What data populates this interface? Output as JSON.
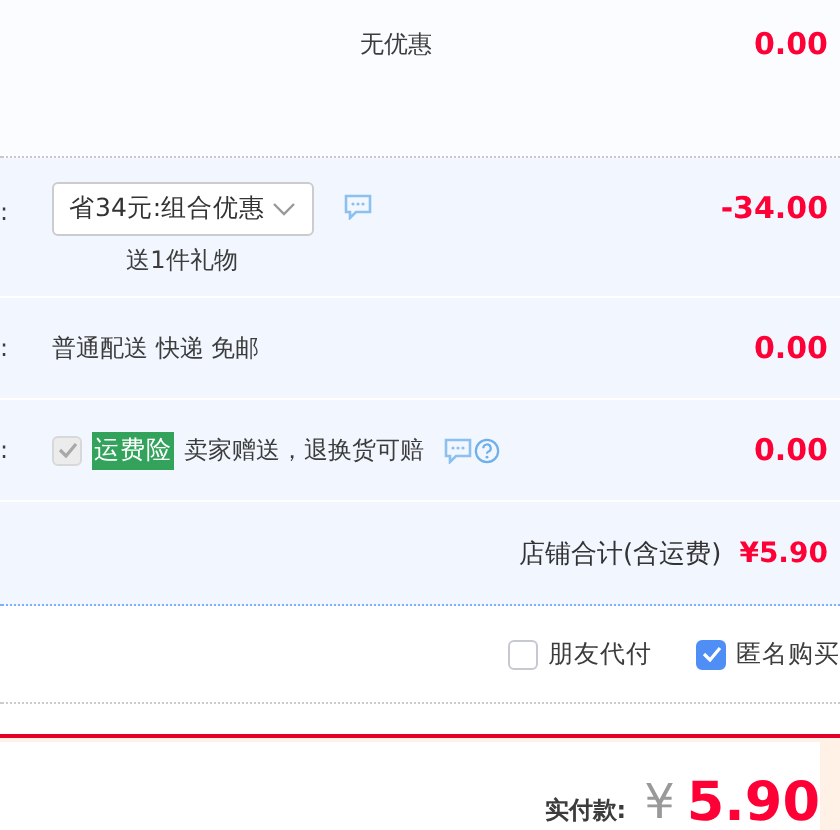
{
  "rows": [
    {
      "kind": "plain",
      "text": "无优惠",
      "amount": "0.00"
    },
    {
      "kind": "promo",
      "label": ":",
      "dropdown": "省34元:组合优惠",
      "note": "送1件礼物",
      "amount": "-34.00"
    },
    {
      "kind": "shipping",
      "label": ":",
      "text": "普通配送 快递 免邮",
      "amount": "0.00"
    },
    {
      "kind": "insurance",
      "label": ":",
      "checked": true,
      "disabled": true,
      "tag": "运费险",
      "text": "卖家赠送，退换货可赔",
      "amount": "0.00"
    }
  ],
  "shop_total": {
    "label": "店铺合计(含运费)",
    "amount": "¥5.90"
  },
  "options": [
    {
      "label": "朋友代付",
      "checked": false
    },
    {
      "label": "匿名购买",
      "checked": true
    }
  ],
  "payment": {
    "label": "实付款:",
    "currency": "¥",
    "amount": "5.90"
  }
}
